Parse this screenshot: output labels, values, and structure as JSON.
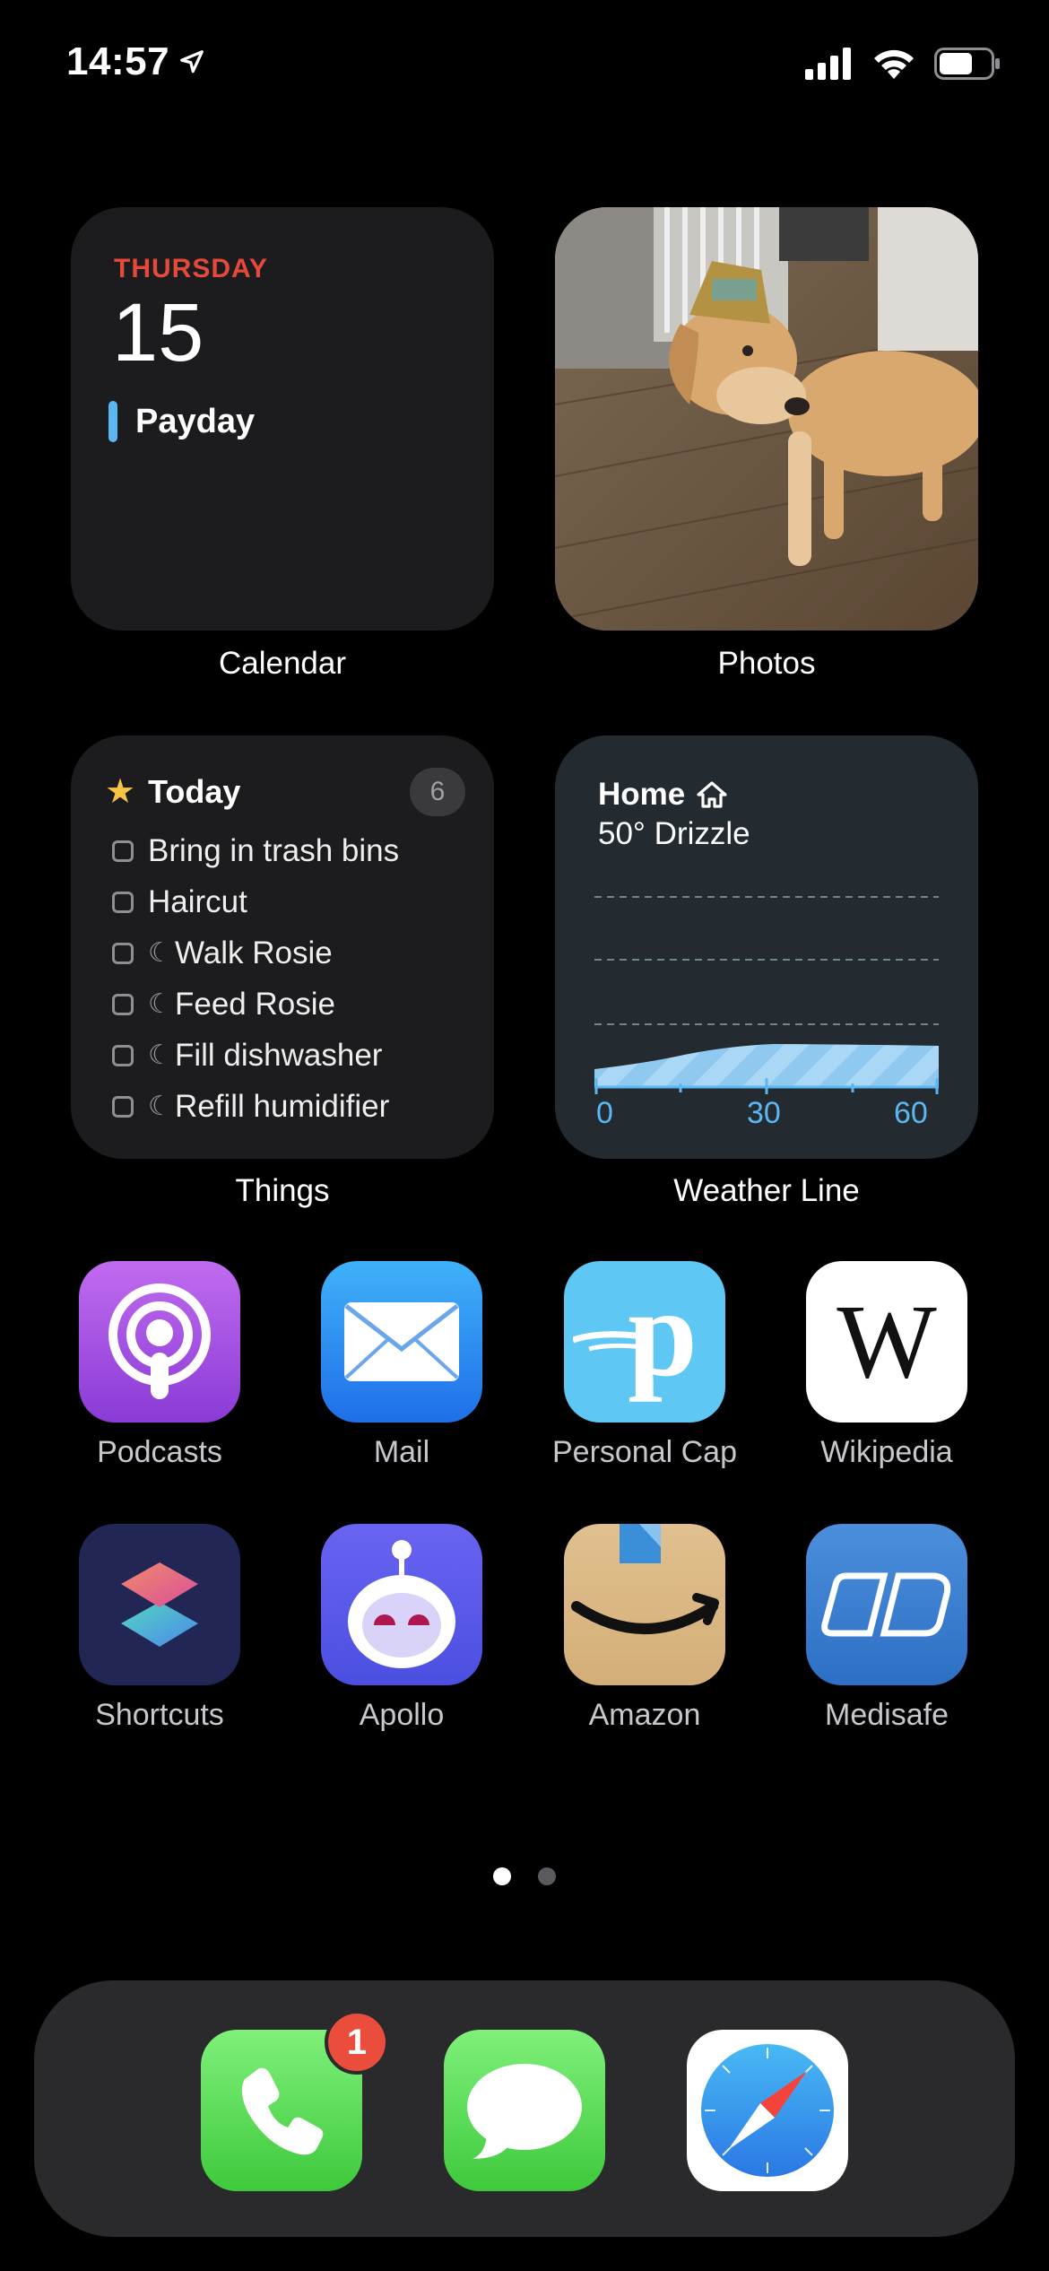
{
  "status_bar": {
    "time": "14:57",
    "location_icon": "location-arrow-icon",
    "signal_icon": "cellular-signal-icon",
    "wifi_icon": "wifi-icon",
    "battery_icon": "battery-icon",
    "battery_level": 0.55
  },
  "widgets": {
    "calendar": {
      "day": "THURSDAY",
      "date": "15",
      "event": "Payday",
      "label": "Calendar",
      "accent": "#e5493a",
      "event_color": "#5ab7f2"
    },
    "photos": {
      "label": "Photos"
    },
    "things": {
      "title": "Today",
      "count": "6",
      "items": [
        {
          "text": "Bring in trash bins",
          "evening": false
        },
        {
          "text": "Haircut",
          "evening": false
        },
        {
          "text": "Walk Rosie",
          "evening": true
        },
        {
          "text": "Feed Rosie",
          "evening": true
        },
        {
          "text": "Fill dishwasher",
          "evening": true
        },
        {
          "text": "Refill humidifier",
          "evening": true
        }
      ],
      "label": "Things"
    },
    "weather_line": {
      "location": "Home",
      "conditions": "50° Drizzle",
      "axis_ticks": [
        "0",
        "30",
        "60"
      ],
      "label": "Weather Line",
      "accent": "#5ab7f2"
    }
  },
  "apps": [
    {
      "name": "Podcasts",
      "icon": "podcasts-icon"
    },
    {
      "name": "Mail",
      "icon": "mail-icon"
    },
    {
      "name": "Personal Cap",
      "icon": "personal-capital-icon"
    },
    {
      "name": "Wikipedia",
      "icon": "wikipedia-icon"
    },
    {
      "name": "Shortcuts",
      "icon": "shortcuts-icon"
    },
    {
      "name": "Apollo",
      "icon": "apollo-icon"
    },
    {
      "name": "Amazon",
      "icon": "amazon-icon"
    },
    {
      "name": "Medisafe",
      "icon": "medisafe-icon"
    }
  ],
  "page_indicator": {
    "pages": 2,
    "current": 1
  },
  "dock": {
    "phone": {
      "icon": "phone-icon",
      "badge": "1"
    },
    "messages": {
      "icon": "messages-icon"
    },
    "safari": {
      "icon": "safari-icon"
    }
  },
  "icon_glyphs": {
    "things_star": "★",
    "moon": "☾",
    "wikipedia": "W",
    "personal_capital": "p"
  }
}
